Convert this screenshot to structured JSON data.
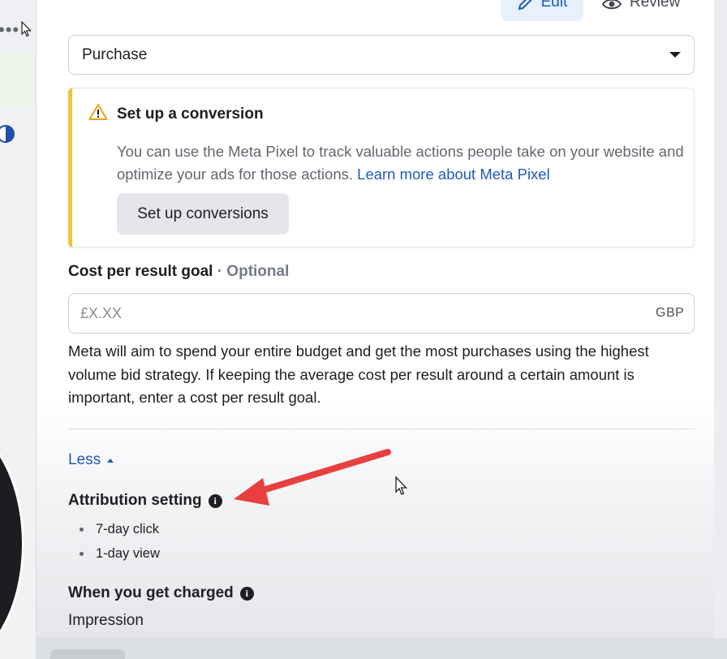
{
  "tabs": {
    "edit_label": "Edit",
    "review_label": "Review"
  },
  "conversion_event": {
    "selected": "Purchase"
  },
  "conversion_warning": {
    "title": "Set up a conversion",
    "body": "You can use the Meta Pixel to track valuable actions people take on your website and optimize your ads for those actions.",
    "link_text": "Learn more about Meta Pixel",
    "button_label": "Set up conversions"
  },
  "cost_per_result": {
    "label": "Cost per result goal",
    "optional": "· Optional",
    "placeholder": "£X.XX",
    "currency": "GBP",
    "help": "Meta will aim to spend your entire budget and get the most purchases using the highest volume bid strategy. If keeping the average cost per result around a certain amount is important, enter a cost per result goal."
  },
  "toggle": {
    "less_label": "Less"
  },
  "attribution": {
    "label": "Attribution setting",
    "items": [
      "7-day click",
      "1-day view"
    ]
  },
  "charged": {
    "label": "When you get charged",
    "value": "Impression"
  },
  "icons": {
    "warning": "warning-triangle-icon",
    "info": "info-icon",
    "pencil": "pencil-icon",
    "eye": "eye-icon"
  },
  "colors": {
    "accent_blue": "#1f5ab8",
    "warning_yellow": "#f0c33c",
    "annotation_red": "#e8403f"
  }
}
